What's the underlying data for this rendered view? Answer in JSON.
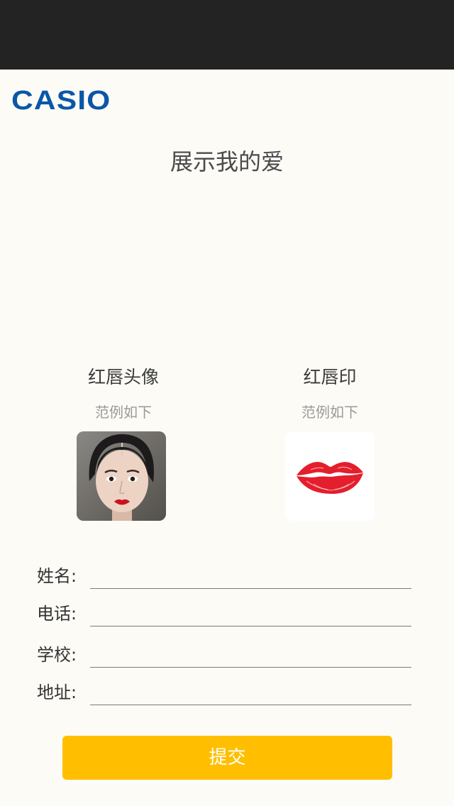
{
  "brand": {
    "logo_text": "CASIO",
    "logo_color": "#0a57a8"
  },
  "header": {
    "title": "展示我的爱"
  },
  "examples": [
    {
      "label": "红唇头像",
      "sub": "范例如下",
      "image": "woman-red-lips-portrait"
    },
    {
      "label": "红唇印",
      "sub": "范例如下",
      "image": "red-lips-print"
    }
  ],
  "form": {
    "fields": [
      {
        "label": "姓名:",
        "value": ""
      },
      {
        "label": "电话:",
        "value": ""
      },
      {
        "label": "学校:",
        "value": ""
      },
      {
        "label": "地址:",
        "value": ""
      }
    ],
    "submit_label": "提交",
    "submit_color": "#ffbf00"
  },
  "colors": {
    "background": "#fcfbf6",
    "top_bar": "#232323"
  }
}
